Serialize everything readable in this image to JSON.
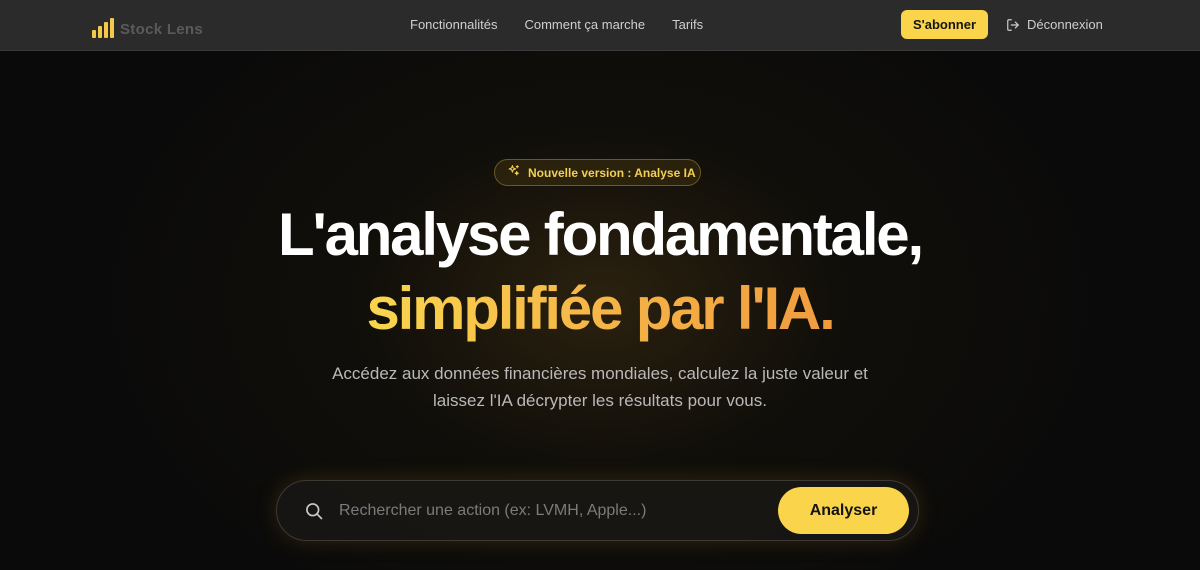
{
  "header": {
    "brand_name": "Stock Lens",
    "brand_color": "#f5c84a",
    "nav": [
      {
        "label": "Fonctionnalités"
      },
      {
        "label": "Comment ça marche"
      },
      {
        "label": "Tarifs"
      }
    ],
    "subscribe_label": "S'abonner",
    "logout_label": "Déconnexion",
    "logout_icon": "logout-icon"
  },
  "hero": {
    "badge_icon": "sparkles-icon",
    "badge_text": "Nouvelle version : Analyse IA",
    "title_line1": "L'analyse fondamentale,",
    "title_line2": "simplifiée par l'IA.",
    "subtitle_line1": "Accédez aux données financières mondiales, calculez la juste valeur et",
    "subtitle_line2": "laissez l'IA décrypter les résultats pour vous."
  },
  "search": {
    "icon": "search-icon",
    "placeholder": "Rechercher une action (ex: LVMH, Apple...)",
    "value": "",
    "button_label": "Analyser"
  },
  "colors": {
    "accent": "#fad44a",
    "gradient_end": "#f09c3f",
    "background": "#0a0a0a",
    "navbar": "#2b2b2c"
  }
}
